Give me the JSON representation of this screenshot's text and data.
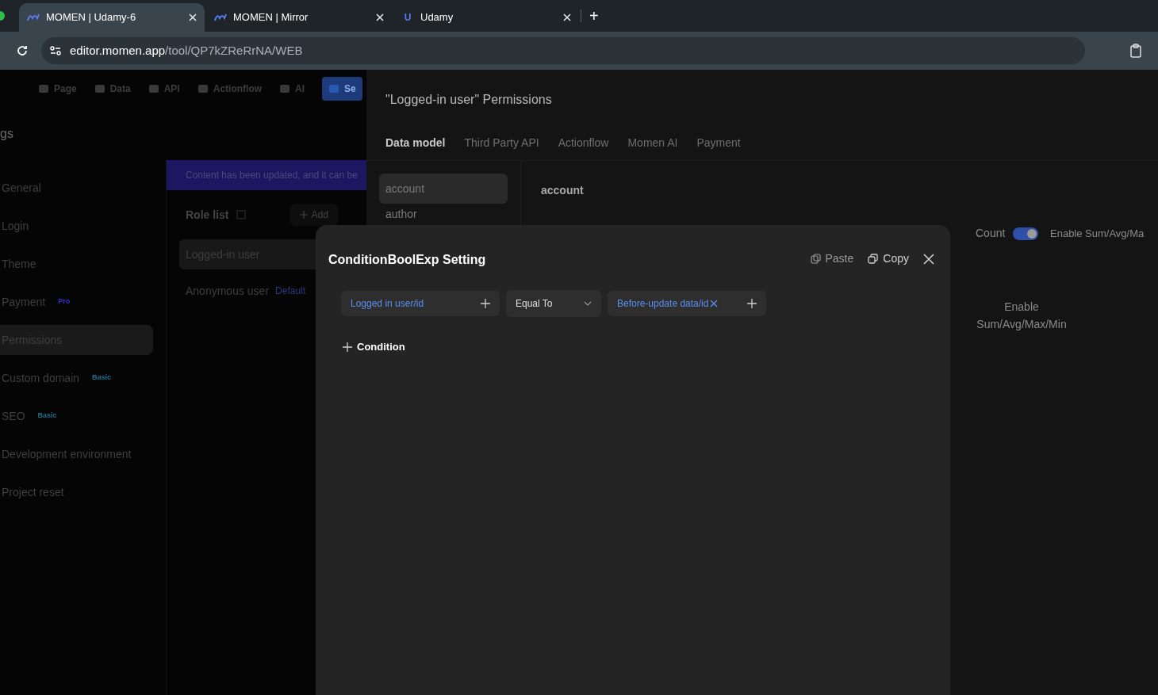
{
  "browser": {
    "tabs": [
      {
        "title": "MOMEN | Udamy-6",
        "selected": true,
        "kind": "momen"
      },
      {
        "title": "MOMEN | Mirror",
        "selected": false,
        "kind": "momen"
      },
      {
        "title": "Udamy",
        "selected": false,
        "kind": "letter",
        "icon_text": "U"
      }
    ],
    "new_tab": "+",
    "url": {
      "host": "editor.momen.app",
      "path": "/tool/QP7kZReRrNA/WEB"
    }
  },
  "toolbar": [
    {
      "label": "Page",
      "selected": false
    },
    {
      "label": "Data",
      "selected": false
    },
    {
      "label": "API",
      "selected": false
    },
    {
      "label": "Actionflow",
      "selected": false
    },
    {
      "label": "AI",
      "selected": false
    },
    {
      "label": "Se",
      "selected": true
    }
  ],
  "sidebar": {
    "title": "gs",
    "items": [
      {
        "label": "General",
        "selected": false
      },
      {
        "label": "Login",
        "selected": false
      },
      {
        "label": "Theme",
        "selected": false
      },
      {
        "label": "Payment",
        "badge": "Pro",
        "color": "#3b2fc9",
        "selected": false
      },
      {
        "label": "Permissions",
        "selected": true
      },
      {
        "label": "Custom domain",
        "badge": "Basic",
        "color": "#1e6f8a",
        "selected": false
      },
      {
        "label": "SEO",
        "badge": "Basic",
        "color": "#1e6f8a",
        "selected": false
      },
      {
        "label": "Development environment",
        "selected": false
      },
      {
        "label": "Project reset",
        "selected": false
      }
    ]
  },
  "banner": "Content has been updated, and it can be",
  "role_list": {
    "title": "Role list",
    "add": "Add",
    "roles": [
      {
        "label": "Logged-in user",
        "selected": true
      },
      {
        "label": "Anonymous user",
        "badge": "Default",
        "selected": false
      }
    ]
  },
  "drawer": {
    "title": "\"Logged-in user\" Permissions",
    "tabs": [
      {
        "label": "Data model",
        "selected": true
      },
      {
        "label": "Third Party API",
        "selected": false
      },
      {
        "label": "Actionflow",
        "selected": false
      },
      {
        "label": "Momen AI",
        "selected": false
      },
      {
        "label": "Payment",
        "selected": false
      }
    ],
    "models": [
      {
        "label": "account",
        "selected": true
      },
      {
        "label": "author",
        "selected": false
      }
    ],
    "model_title": "account",
    "count": {
      "label": "Count",
      "on": true
    },
    "enable_label": "Enable Sum/Avg/Ma",
    "column_header": "Enable Sum/Avg/Max/Min"
  },
  "modal": {
    "title": "ConditionBoolExp Setting",
    "paste": "Paste",
    "copy": "Copy",
    "left": "Logged in user/id",
    "operator": "Equal To",
    "right": "Before-update data/id",
    "add_condition": "Condition"
  }
}
